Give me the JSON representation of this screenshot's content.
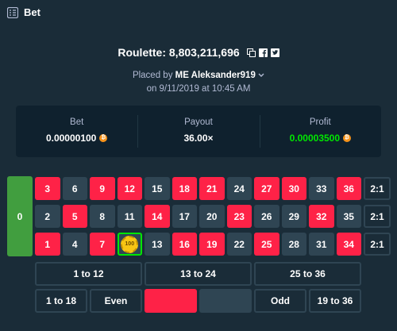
{
  "header": {
    "title": "Bet",
    "icon": "bet-slip-icon"
  },
  "bet_info": {
    "game_label": "Roulette: 8,803,211,696",
    "placed_prefix": "Placed by ",
    "user": "ME Aleksander919",
    "date": "on 9/11/2019 at 10:45 AM"
  },
  "stats": {
    "bet_label": "Bet",
    "bet_value": "0.00000100",
    "payout_label": "Payout",
    "payout_value": "36.00×",
    "profit_label": "Profit",
    "profit_value": "0.00003500"
  },
  "colors": {
    "red": "#fe2247",
    "black": "#2f4553",
    "green": "#419e3f",
    "profit": "#00e701",
    "btc": "#f7931a"
  },
  "board": {
    "zero": "0",
    "rows": [
      [
        {
          "n": "3",
          "c": "red"
        },
        {
          "n": "6",
          "c": "black"
        },
        {
          "n": "9",
          "c": "red"
        },
        {
          "n": "12",
          "c": "red"
        },
        {
          "n": "15",
          "c": "black"
        },
        {
          "n": "18",
          "c": "red"
        },
        {
          "n": "21",
          "c": "red"
        },
        {
          "n": "24",
          "c": "black"
        },
        {
          "n": "27",
          "c": "red"
        },
        {
          "n": "30",
          "c": "red"
        },
        {
          "n": "33",
          "c": "black"
        },
        {
          "n": "36",
          "c": "red"
        }
      ],
      [
        {
          "n": "2",
          "c": "black"
        },
        {
          "n": "5",
          "c": "red"
        },
        {
          "n": "8",
          "c": "black"
        },
        {
          "n": "11",
          "c": "black"
        },
        {
          "n": "14",
          "c": "red"
        },
        {
          "n": "17",
          "c": "black"
        },
        {
          "n": "20",
          "c": "black"
        },
        {
          "n": "23",
          "c": "red"
        },
        {
          "n": "26",
          "c": "black"
        },
        {
          "n": "29",
          "c": "black"
        },
        {
          "n": "32",
          "c": "red"
        },
        {
          "n": "35",
          "c": "black"
        }
      ],
      [
        {
          "n": "1",
          "c": "red"
        },
        {
          "n": "4",
          "c": "black"
        },
        {
          "n": "7",
          "c": "red"
        },
        {
          "n": "10",
          "c": "black"
        },
        {
          "n": "13",
          "c": "black"
        },
        {
          "n": "16",
          "c": "red"
        },
        {
          "n": "19",
          "c": "red"
        },
        {
          "n": "22",
          "c": "black"
        },
        {
          "n": "25",
          "c": "red"
        },
        {
          "n": "28",
          "c": "black"
        },
        {
          "n": "31",
          "c": "black"
        },
        {
          "n": "34",
          "c": "red"
        }
      ]
    ],
    "column_bets": [
      "2:1",
      "2:1",
      "2:1"
    ],
    "dozens": [
      "1 to 12",
      "13 to 24",
      "25 to 36"
    ],
    "outside": [
      "1 to 18",
      "Even",
      "",
      "",
      "Odd",
      "19 to 36"
    ],
    "chip_value": "100",
    "chip_on": "10"
  }
}
